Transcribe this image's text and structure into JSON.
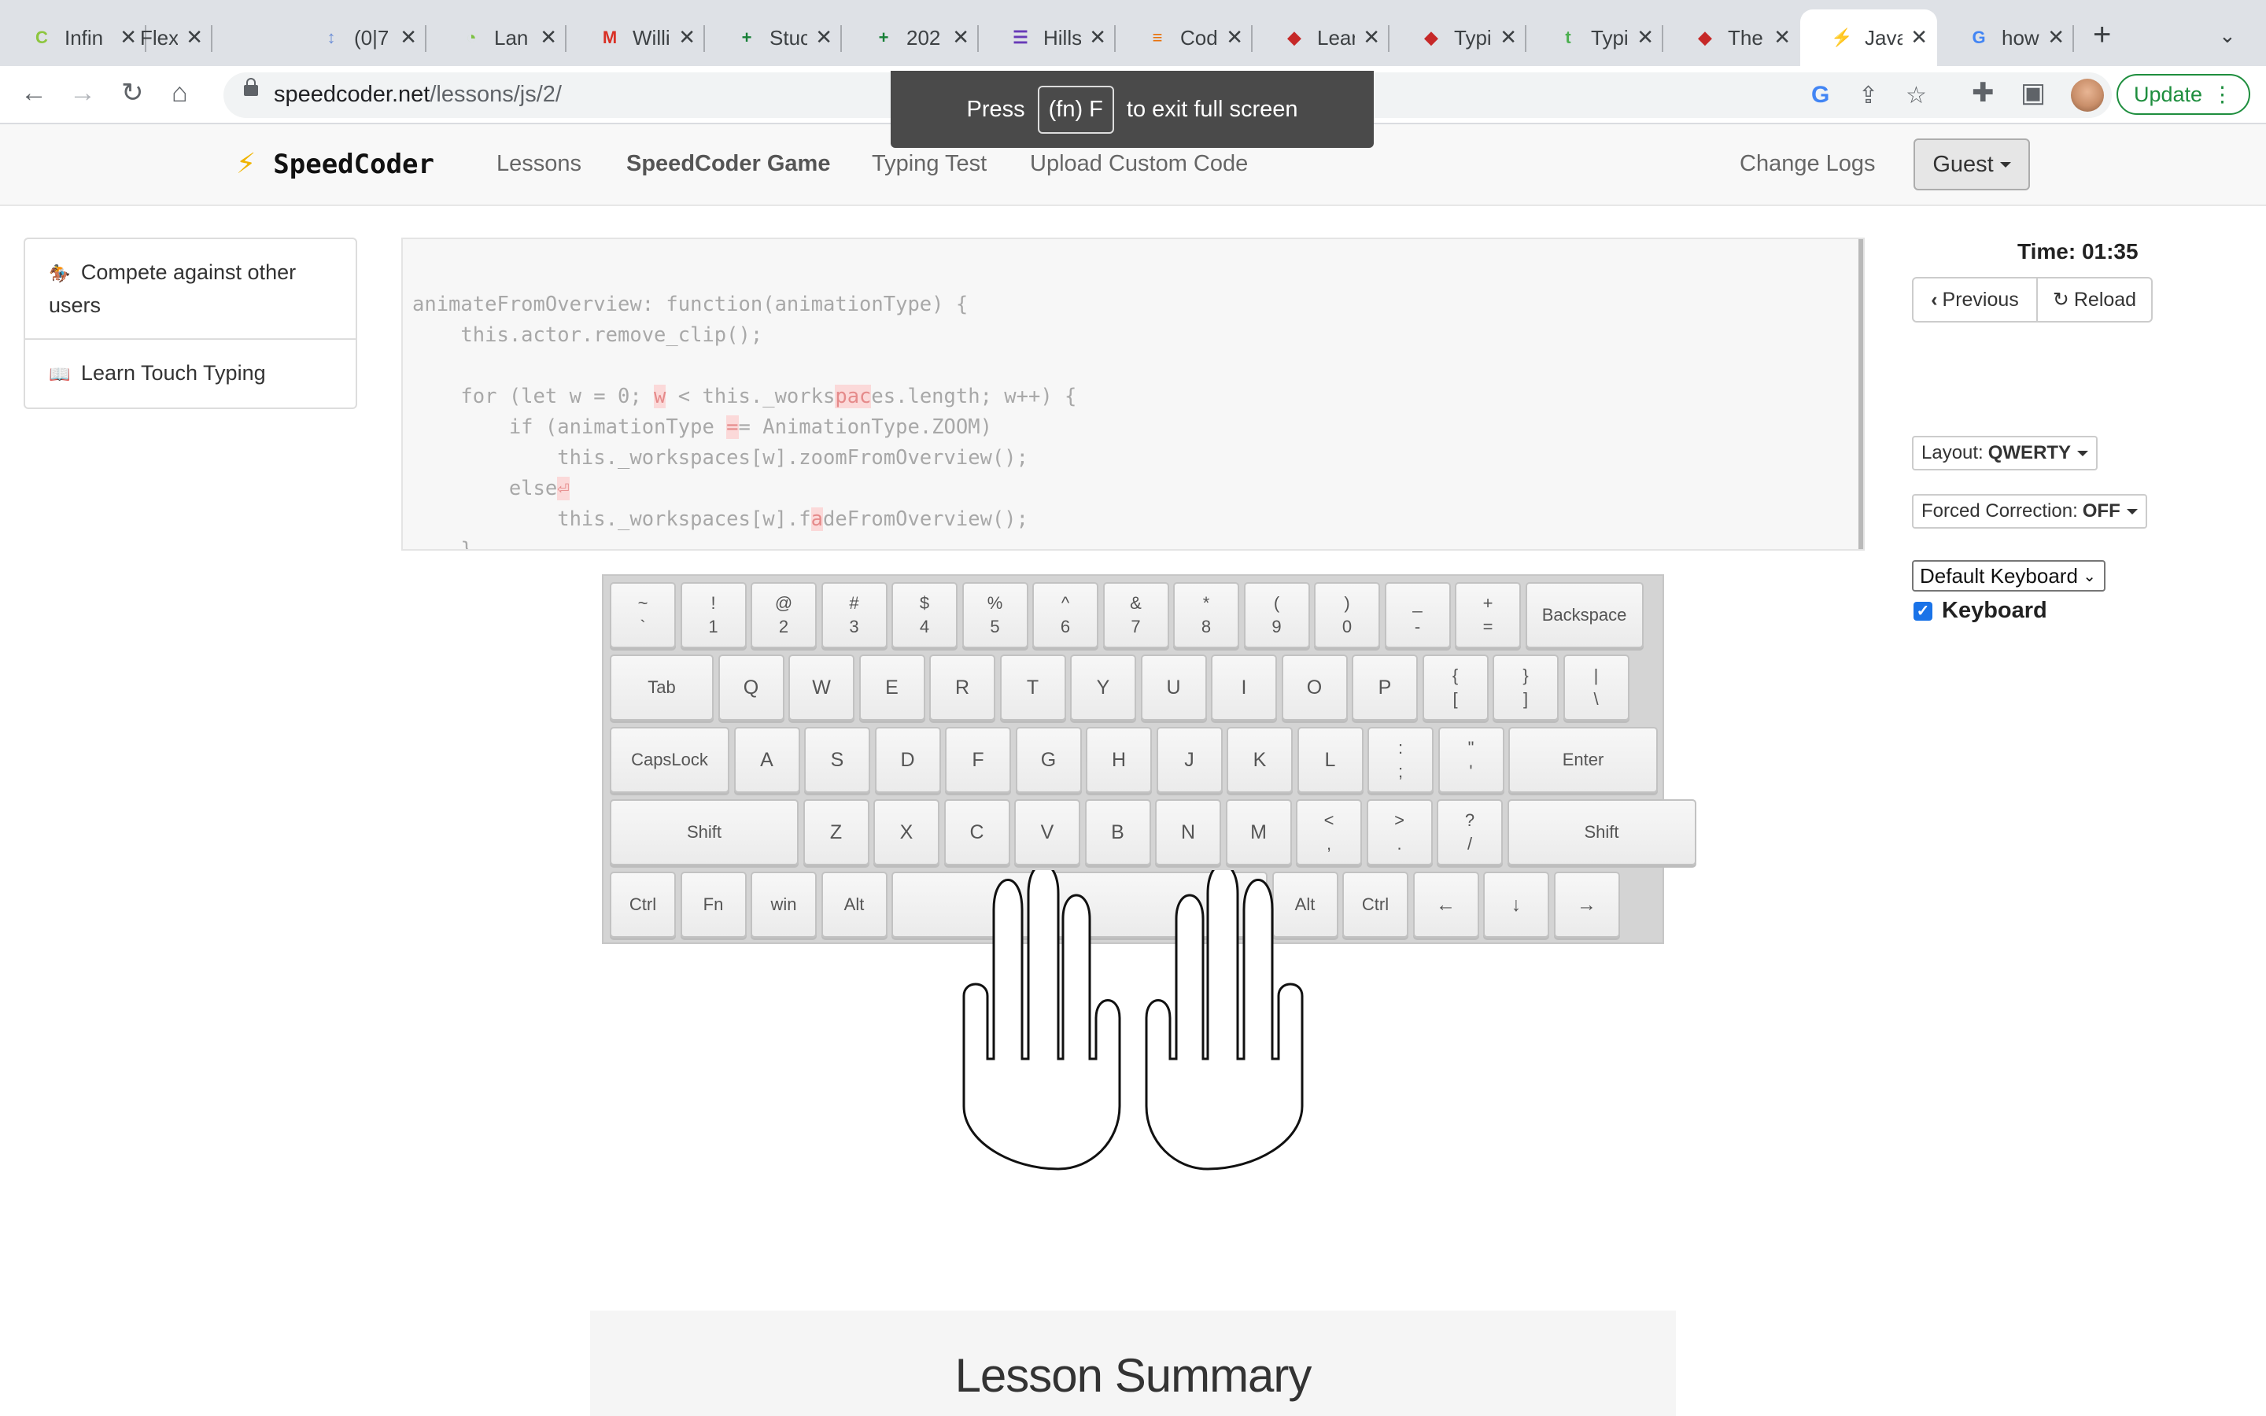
{
  "browser": {
    "tabs": [
      {
        "title": "Infin",
        "favicon": "C",
        "color": "#8dc63f"
      },
      {
        "title": "Flex",
        "favicon": "",
        "color": "#888888"
      },
      {
        "title": "(0|7",
        "favicon": "↕",
        "color": "#6b8dd6"
      },
      {
        "title": "Lan",
        "favicon": "◔",
        "color": "#7cc142"
      },
      {
        "title": "Willi",
        "favicon": "M",
        "color": "#d93025"
      },
      {
        "title": "Stuc",
        "favicon": "+",
        "color": "#188038"
      },
      {
        "title": "202",
        "favicon": "+",
        "color": "#188038"
      },
      {
        "title": "Hills",
        "favicon": "☰",
        "color": "#673ab7"
      },
      {
        "title": "Cod",
        "favicon": "≡",
        "color": "#e8710a"
      },
      {
        "title": "Lear",
        "favicon": "◆",
        "color": "#c62828"
      },
      {
        "title": "Typi",
        "favicon": "◆",
        "color": "#c62828"
      },
      {
        "title": "Typi",
        "favicon": "t",
        "color": "#4caf50"
      },
      {
        "title": "The",
        "favicon": "◆",
        "color": "#c62828"
      },
      {
        "title": "Java",
        "favicon": "⚡",
        "color": "#333333"
      },
      {
        "title": "how",
        "favicon": "G",
        "color": "#4285f4"
      }
    ],
    "url_host": "speedcoder.net",
    "url_path": "/lessons/js/2/",
    "update_label": "Update",
    "fullscreen_pre": "Press",
    "fullscreen_key": "(fn) F",
    "fullscreen_post": "to exit full screen"
  },
  "nav": {
    "brand": "SpeedCoder",
    "links": [
      "Lessons",
      "SpeedCoder Game",
      "Typing Test",
      "Upload Custom Code"
    ],
    "change_logs": "Change Logs",
    "user": "Guest"
  },
  "sidebar": {
    "items": [
      {
        "icon": "🏇",
        "label": "Compete against other users"
      },
      {
        "icon": "📖",
        "label": "Learn Touch Typing"
      }
    ]
  },
  "lesson": {
    "code_lines": [
      "animateFromOverview: function(animationType) {",
      "    this.actor.remove_clip();",
      "",
      "    for (let w = 0; w < this._workspaces.length; w++) {",
      "        if (animationType == AnimationType.ZOOM)",
      "            this._workspaces[w].zoomFromOverview();",
      "        else⏎",
      "            this._workspaces[w].fadeFromOverview();",
      "    }"
    ]
  },
  "panel": {
    "time_label": "Time:",
    "time_value": "01:35",
    "previous_label": "Previous",
    "reload_label": "Reload",
    "layout_label": "Layout:",
    "layout_value": "QWERTY",
    "forced_label": "Forced Correction:",
    "forced_value": "OFF",
    "keyboard_select": "Default Keyboard",
    "keyboard_checkbox": "Keyboard",
    "keyboard_checked": true
  },
  "keyboard": {
    "rows": [
      [
        [
          "~",
          "`"
        ],
        [
          "!",
          "1"
        ],
        [
          "@",
          "2"
        ],
        [
          "#",
          "3"
        ],
        [
          "$",
          "4"
        ],
        [
          "%",
          "5"
        ],
        [
          "^",
          "6"
        ],
        [
          "&",
          "7"
        ],
        [
          "*",
          "8"
        ],
        [
          "(",
          "9"
        ],
        [
          ")",
          "0"
        ],
        [
          "_",
          "-"
        ],
        [
          "+",
          "="
        ],
        [
          "Backspace"
        ]
      ],
      [
        [
          "Tab"
        ],
        [
          "Q"
        ],
        [
          "W"
        ],
        [
          "E"
        ],
        [
          "R"
        ],
        [
          "T"
        ],
        [
          "Y"
        ],
        [
          "U"
        ],
        [
          "I"
        ],
        [
          "O"
        ],
        [
          "P"
        ],
        [
          "{",
          "["
        ],
        [
          "}",
          "]"
        ],
        [
          "|",
          "\\"
        ]
      ],
      [
        [
          "CapsLock"
        ],
        [
          "A"
        ],
        [
          "S"
        ],
        [
          "D"
        ],
        [
          "F"
        ],
        [
          "G"
        ],
        [
          "H"
        ],
        [
          "J"
        ],
        [
          "K"
        ],
        [
          "L"
        ],
        [
          ":",
          ";"
        ],
        [
          "\"",
          "'"
        ],
        [
          "Enter"
        ]
      ],
      [
        [
          "Shift"
        ],
        [
          "Z"
        ],
        [
          "X"
        ],
        [
          "C"
        ],
        [
          "V"
        ],
        [
          "B"
        ],
        [
          "N"
        ],
        [
          "M"
        ],
        [
          "<",
          ","
        ],
        [
          ">",
          "."
        ],
        [
          "?",
          "/"
        ],
        [
          "Shift"
        ]
      ],
      [
        [
          "Ctrl"
        ],
        [
          "Fn"
        ],
        [
          "win"
        ],
        [
          "Alt"
        ],
        [
          " "
        ],
        [
          "Alt"
        ],
        [
          "Ctrl"
        ],
        [
          "←"
        ],
        [
          "↓"
        ],
        [
          "→"
        ]
      ]
    ]
  },
  "summary": {
    "title": "Lesson Summary"
  }
}
